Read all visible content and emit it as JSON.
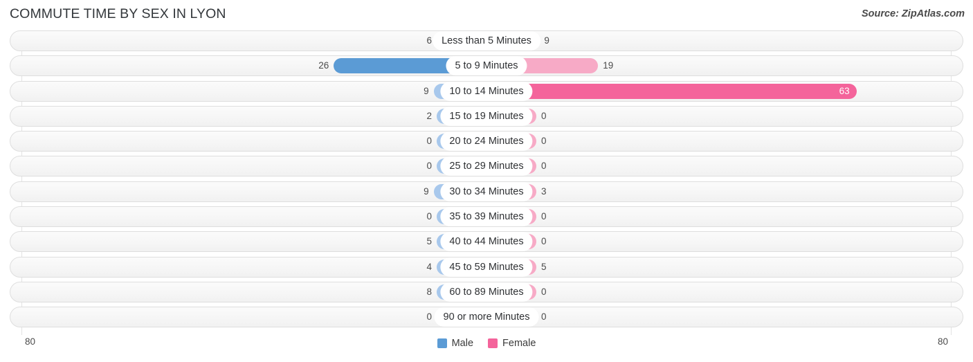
{
  "header": {
    "title": "COMMUTE TIME BY SEX IN LYON",
    "source": "Source: ZipAtlas.com"
  },
  "axis": {
    "left_label": "80",
    "right_label": "80",
    "max": 80
  },
  "legend": {
    "items": [
      {
        "label": "Male",
        "color": "#5b9bd5"
      },
      {
        "label": "Female",
        "color": "#f4649b"
      }
    ]
  },
  "colors": {
    "male_strong": "#5b9bd5",
    "male_light": "#a8c8ec",
    "female_strong": "#f4649b",
    "female_light": "#f7aac6",
    "track_border": "#dedede",
    "gridline": "#e2e2e2"
  },
  "chart_data": {
    "type": "bar",
    "title": "COMMUTE TIME BY SEX IN LYON",
    "subtitle": "Source: ZipAtlas.com",
    "orientation": "horizontal-diverging",
    "xlabel": "",
    "ylabel": "",
    "xlim": [
      -80,
      80
    ],
    "axis_left_max": 80,
    "axis_right_max": 80,
    "grid": true,
    "legend_position": "bottom-center",
    "categories": [
      "Less than 5 Minutes",
      "5 to 9 Minutes",
      "10 to 14 Minutes",
      "15 to 19 Minutes",
      "20 to 24 Minutes",
      "25 to 29 Minutes",
      "30 to 34 Minutes",
      "35 to 39 Minutes",
      "40 to 44 Minutes",
      "45 to 59 Minutes",
      "60 to 89 Minutes",
      "90 or more Minutes"
    ],
    "series": [
      {
        "name": "Male",
        "values": [
          6,
          26,
          9,
          2,
          0,
          0,
          9,
          0,
          5,
          4,
          8,
          0
        ]
      },
      {
        "name": "Female",
        "values": [
          9,
          19,
          63,
          0,
          0,
          0,
          3,
          0,
          0,
          5,
          0,
          0
        ]
      }
    ]
  },
  "rows": [
    {
      "label": "Less than 5 Minutes",
      "male": 6,
      "female": 9
    },
    {
      "label": "5 to 9 Minutes",
      "male": 26,
      "female": 19
    },
    {
      "label": "10 to 14 Minutes",
      "male": 9,
      "female": 63
    },
    {
      "label": "15 to 19 Minutes",
      "male": 2,
      "female": 0
    },
    {
      "label": "20 to 24 Minutes",
      "male": 0,
      "female": 0
    },
    {
      "label": "25 to 29 Minutes",
      "male": 0,
      "female": 0
    },
    {
      "label": "30 to 34 Minutes",
      "male": 9,
      "female": 3
    },
    {
      "label": "35 to 39 Minutes",
      "male": 0,
      "female": 0
    },
    {
      "label": "40 to 44 Minutes",
      "male": 5,
      "female": 0
    },
    {
      "label": "45 to 59 Minutes",
      "male": 4,
      "female": 5
    },
    {
      "label": "60 to 89 Minutes",
      "male": 8,
      "female": 0
    },
    {
      "label": "90 or more Minutes",
      "male": 0,
      "female": 0
    }
  ]
}
